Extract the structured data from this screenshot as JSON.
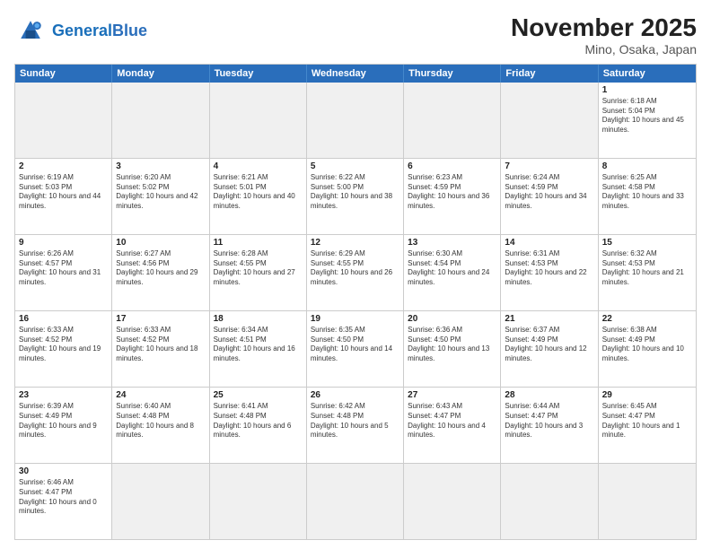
{
  "header": {
    "logo_general": "General",
    "logo_blue": "Blue",
    "month_title": "November 2025",
    "location": "Mino, Osaka, Japan"
  },
  "weekdays": [
    "Sunday",
    "Monday",
    "Tuesday",
    "Wednesday",
    "Thursday",
    "Friday",
    "Saturday"
  ],
  "rows": [
    [
      {
        "day": "",
        "empty": true
      },
      {
        "day": "",
        "empty": true
      },
      {
        "day": "",
        "empty": true
      },
      {
        "day": "",
        "empty": true
      },
      {
        "day": "",
        "empty": true
      },
      {
        "day": "",
        "empty": true
      },
      {
        "day": "1",
        "sunrise": "6:18 AM",
        "sunset": "5:04 PM",
        "daylight": "10 hours and 45 minutes."
      }
    ],
    [
      {
        "day": "2",
        "sunrise": "6:19 AM",
        "sunset": "5:03 PM",
        "daylight": "10 hours and 44 minutes."
      },
      {
        "day": "3",
        "sunrise": "6:20 AM",
        "sunset": "5:02 PM",
        "daylight": "10 hours and 42 minutes."
      },
      {
        "day": "4",
        "sunrise": "6:21 AM",
        "sunset": "5:01 PM",
        "daylight": "10 hours and 40 minutes."
      },
      {
        "day": "5",
        "sunrise": "6:22 AM",
        "sunset": "5:00 PM",
        "daylight": "10 hours and 38 minutes."
      },
      {
        "day": "6",
        "sunrise": "6:23 AM",
        "sunset": "4:59 PM",
        "daylight": "10 hours and 36 minutes."
      },
      {
        "day": "7",
        "sunrise": "6:24 AM",
        "sunset": "4:59 PM",
        "daylight": "10 hours and 34 minutes."
      },
      {
        "day": "8",
        "sunrise": "6:25 AM",
        "sunset": "4:58 PM",
        "daylight": "10 hours and 33 minutes."
      }
    ],
    [
      {
        "day": "9",
        "sunrise": "6:26 AM",
        "sunset": "4:57 PM",
        "daylight": "10 hours and 31 minutes."
      },
      {
        "day": "10",
        "sunrise": "6:27 AM",
        "sunset": "4:56 PM",
        "daylight": "10 hours and 29 minutes."
      },
      {
        "day": "11",
        "sunrise": "6:28 AM",
        "sunset": "4:55 PM",
        "daylight": "10 hours and 27 minutes."
      },
      {
        "day": "12",
        "sunrise": "6:29 AM",
        "sunset": "4:55 PM",
        "daylight": "10 hours and 26 minutes."
      },
      {
        "day": "13",
        "sunrise": "6:30 AM",
        "sunset": "4:54 PM",
        "daylight": "10 hours and 24 minutes."
      },
      {
        "day": "14",
        "sunrise": "6:31 AM",
        "sunset": "4:53 PM",
        "daylight": "10 hours and 22 minutes."
      },
      {
        "day": "15",
        "sunrise": "6:32 AM",
        "sunset": "4:53 PM",
        "daylight": "10 hours and 21 minutes."
      }
    ],
    [
      {
        "day": "16",
        "sunrise": "6:33 AM",
        "sunset": "4:52 PM",
        "daylight": "10 hours and 19 minutes."
      },
      {
        "day": "17",
        "sunrise": "6:33 AM",
        "sunset": "4:52 PM",
        "daylight": "10 hours and 18 minutes."
      },
      {
        "day": "18",
        "sunrise": "6:34 AM",
        "sunset": "4:51 PM",
        "daylight": "10 hours and 16 minutes."
      },
      {
        "day": "19",
        "sunrise": "6:35 AM",
        "sunset": "4:50 PM",
        "daylight": "10 hours and 14 minutes."
      },
      {
        "day": "20",
        "sunrise": "6:36 AM",
        "sunset": "4:50 PM",
        "daylight": "10 hours and 13 minutes."
      },
      {
        "day": "21",
        "sunrise": "6:37 AM",
        "sunset": "4:49 PM",
        "daylight": "10 hours and 12 minutes."
      },
      {
        "day": "22",
        "sunrise": "6:38 AM",
        "sunset": "4:49 PM",
        "daylight": "10 hours and 10 minutes."
      }
    ],
    [
      {
        "day": "23",
        "sunrise": "6:39 AM",
        "sunset": "4:49 PM",
        "daylight": "10 hours and 9 minutes."
      },
      {
        "day": "24",
        "sunrise": "6:40 AM",
        "sunset": "4:48 PM",
        "daylight": "10 hours and 8 minutes."
      },
      {
        "day": "25",
        "sunrise": "6:41 AM",
        "sunset": "4:48 PM",
        "daylight": "10 hours and 6 minutes."
      },
      {
        "day": "26",
        "sunrise": "6:42 AM",
        "sunset": "4:48 PM",
        "daylight": "10 hours and 5 minutes."
      },
      {
        "day": "27",
        "sunrise": "6:43 AM",
        "sunset": "4:47 PM",
        "daylight": "10 hours and 4 minutes."
      },
      {
        "day": "28",
        "sunrise": "6:44 AM",
        "sunset": "4:47 PM",
        "daylight": "10 hours and 3 minutes."
      },
      {
        "day": "29",
        "sunrise": "6:45 AM",
        "sunset": "4:47 PM",
        "daylight": "10 hours and 1 minute."
      }
    ],
    [
      {
        "day": "30",
        "sunrise": "6:46 AM",
        "sunset": "4:47 PM",
        "daylight": "10 hours and 0 minutes."
      },
      {
        "day": "",
        "empty": true
      },
      {
        "day": "",
        "empty": true
      },
      {
        "day": "",
        "empty": true
      },
      {
        "day": "",
        "empty": true
      },
      {
        "day": "",
        "empty": true
      },
      {
        "day": "",
        "empty": true
      }
    ]
  ]
}
